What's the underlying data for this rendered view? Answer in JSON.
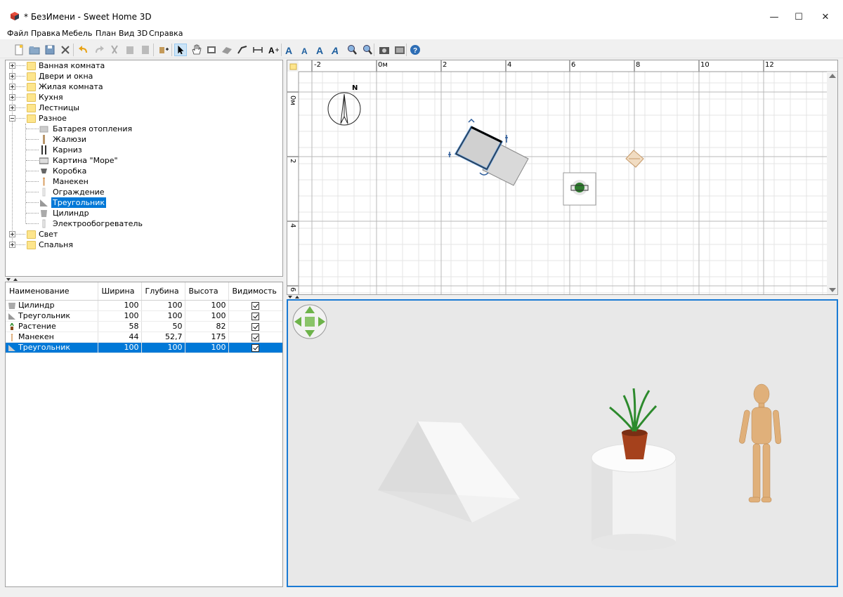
{
  "window": {
    "title": "* БезИмени - Sweet Home 3D",
    "minimize_glyph": "—",
    "maximize_glyph": "☐",
    "close_glyph": "✕"
  },
  "menu": [
    "Файл",
    "Правка",
    "Мебель",
    "План",
    "Вид 3D",
    "Справка"
  ],
  "toolbar_icons": [
    "new-home-icon",
    "open-icon",
    "save-icon",
    "cut-prefs-icon",
    "undo-icon",
    "redo-icon",
    "cut-icon",
    "copy-icon",
    "paste-icon",
    "add-furniture-icon",
    "select-mode-icon",
    "pan-mode-icon",
    "create-walls-icon",
    "create-rooms-icon",
    "create-polylines-icon",
    "create-dimensions-icon",
    "create-labels-icon",
    "increase-text-icon",
    "decrease-text-icon",
    "bold-text-icon",
    "italic-text-icon",
    "zoom-in-icon",
    "zoom-out-icon",
    "create-photo-icon",
    "create-video-icon",
    "help-icon"
  ],
  "catalog": {
    "categories_before": [
      "Ванная комната",
      "Двери и окна",
      "Жилая комната",
      "Кухня",
      "Лестницы"
    ],
    "open_category": "Разное",
    "items": [
      {
        "label": "Батарея отопления",
        "icon": "radiator-icon"
      },
      {
        "label": "Жалюзи",
        "icon": "blinds-icon"
      },
      {
        "label": "Карниз",
        "icon": "curtain-rod-icon"
      },
      {
        "label": "Картина \"Море\"",
        "icon": "painting-icon"
      },
      {
        "label": "Коробка",
        "icon": "box-icon"
      },
      {
        "label": "Манекен",
        "icon": "mannequin-icon"
      },
      {
        "label": "Ограждение",
        "icon": "railing-icon"
      },
      {
        "label": "Треугольник",
        "icon": "triangle-icon",
        "selected": true
      },
      {
        "label": "Цилиндр",
        "icon": "cylinder-icon"
      },
      {
        "label": "Электрообогреватель",
        "icon": "heater-icon"
      }
    ],
    "categories_after": [
      "Свет",
      "Спальня"
    ]
  },
  "furniture_table": {
    "columns": [
      "Наименование",
      "Ширина",
      "Глубина",
      "Высота",
      "Видимость"
    ],
    "rows": [
      {
        "name": "Цилиндр",
        "width": "100",
        "depth": "100",
        "height": "100",
        "visible": true,
        "icon": "cylinder-icon"
      },
      {
        "name": "Треугольник",
        "width": "100",
        "depth": "100",
        "height": "100",
        "visible": true,
        "icon": "triangle-icon"
      },
      {
        "name": "Растение",
        "width": "58",
        "depth": "50",
        "height": "82",
        "visible": true,
        "icon": "plant-icon"
      },
      {
        "name": "Манекен",
        "width": "44",
        "depth": "52,7",
        "height": "175",
        "visible": true,
        "icon": "mannequin-icon"
      },
      {
        "name": "Треугольник",
        "width": "100",
        "depth": "100",
        "height": "100",
        "visible": true,
        "icon": "triangle-icon",
        "selected": true
      }
    ]
  },
  "plan": {
    "ruler_x": [
      "-2",
      "0м",
      "2",
      "4",
      "6",
      "8",
      "10",
      "12"
    ],
    "ruler_y": [
      "0м",
      "2",
      "4",
      "6"
    ],
    "compass_label": "N"
  },
  "colors": {
    "selection": "#0078d7",
    "view_border": "#1a7ad4",
    "folder": "#fde58c"
  }
}
